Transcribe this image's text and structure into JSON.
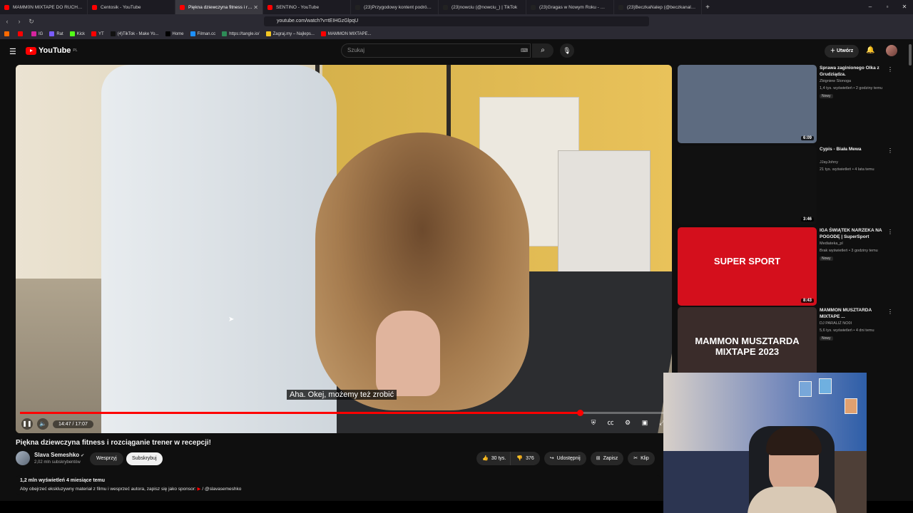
{
  "browser": {
    "tabs": [
      {
        "label": "MAMM0N MIXTAPE DO RUCH@NIA",
        "color": "#ff0000"
      },
      {
        "label": "Centosik - YouTube",
        "color": "#ff0000"
      },
      {
        "label": "Piękna dziewczyna fitness i rozc",
        "color": "#ff0000",
        "active": true
      },
      {
        "label": "SENTINO - YouTube",
        "color": "#ff0000"
      },
      {
        "label": "(23)Przygodowy kontent podróżnicz",
        "color": "#222"
      },
      {
        "label": "(23)nowciu (@nowciu_) | TikTok",
        "color": "#222"
      },
      {
        "label": "(23)Gragas w Nowym Roku - Wesoły",
        "color": "#222"
      },
      {
        "label": "(23)BeczkaNalep (@beczkanalep) | T",
        "color": "#222"
      }
    ],
    "new_tab": "+",
    "url": "youtube.com/watch?v=tEIHGzGlpqU",
    "bookmarks": [
      {
        "label": "",
        "color": "#ff6a00"
      },
      {
        "label": "",
        "color": "#ff0000"
      },
      {
        "label": "IG",
        "color": "#d6249f"
      },
      {
        "label": "Rat",
        "color": "#7a5cff"
      },
      {
        "label": "Kick",
        "color": "#53fc18"
      },
      {
        "label": "YT",
        "color": "#ff0000"
      },
      {
        "label": "(4)TikTok - Make Yo...",
        "color": "#111"
      },
      {
        "label": "Home",
        "color": "#000"
      },
      {
        "label": "Filman.cc",
        "color": "#1e90ff"
      },
      {
        "label": "https://tangle.io/",
        "color": "#2e8b57"
      },
      {
        "label": "Zagraj.my – Najleps...",
        "color": "#f3c623"
      },
      {
        "label": "MAMMON MIXTAPE...",
        "color": "#ff0000"
      }
    ]
  },
  "yt": {
    "logo": "YouTube",
    "region": "PL",
    "search_placeholder": "Szukaj",
    "create_label": "Utwórz"
  },
  "video": {
    "subtitle": "Aha. Okej, możemy też zrobić",
    "time": "14:47 / 17:07",
    "progress": 0.864,
    "title": "Piękna dziewczyna fitness i rozciąganie trener w recepcji!",
    "channel": "Slava Semeshko",
    "subscribers": "2,02 mln subskrybentów",
    "support_label": "Wesprzyj",
    "subscribe_label": "Subskrybuj",
    "likes": "30 tys.",
    "dislikes": "376",
    "share_label": "Udostępnij",
    "save_label": "Zapisz",
    "clip_label": "Klip",
    "views_line": "1,2 mln wyświetleń  4 miesiące temu",
    "desc_line": "Aby obejrzeć ekskluzywny materiał z filmu i wesprzeć autora, zapisz się jako sponsor: ",
    "desc_link": "/ @slavasemeshko"
  },
  "related": [
    {
      "title": "Sprawa zaginionego Olka z Grudziądza.",
      "channel": "Zbigniew Stonoga",
      "meta": "1,4 tys. wyświetleń • 2 godziny temu",
      "badge": "Nowy",
      "duration": "6:09",
      "thumb": "#5d6b80"
    },
    {
      "title": "Cypis - Biała Mewa",
      "channel": "JJayJohny",
      "meta": "21 tys. wyświetleń • 4 lata temu",
      "badge": "",
      "duration": "3:46",
      "thumb": "#111111"
    },
    {
      "title": "IGA ŚWIĄTEK NARZEKA NA POGODĘ | SuperSport",
      "channel": "Mediateka_pl",
      "meta": "Brak wyświetleń • 3 godziny temu",
      "badge": "Nowy",
      "duration": "8:43",
      "thumb": "#d40f1c",
      "thumb_text": "SUPER SPORT"
    },
    {
      "title": "MAMMON MUSZTARDA MIXTAPE ...",
      "channel": "DJ PARALIŻ NO0I",
      "meta": "5,6 tys. wyświetleń • 4 dni temu",
      "badge": "Nowy",
      "duration": "",
      "thumb": "#3a2c2a",
      "thumb_text": "MAMMON MUSZTARDA MIXTAPE 2023"
    }
  ]
}
